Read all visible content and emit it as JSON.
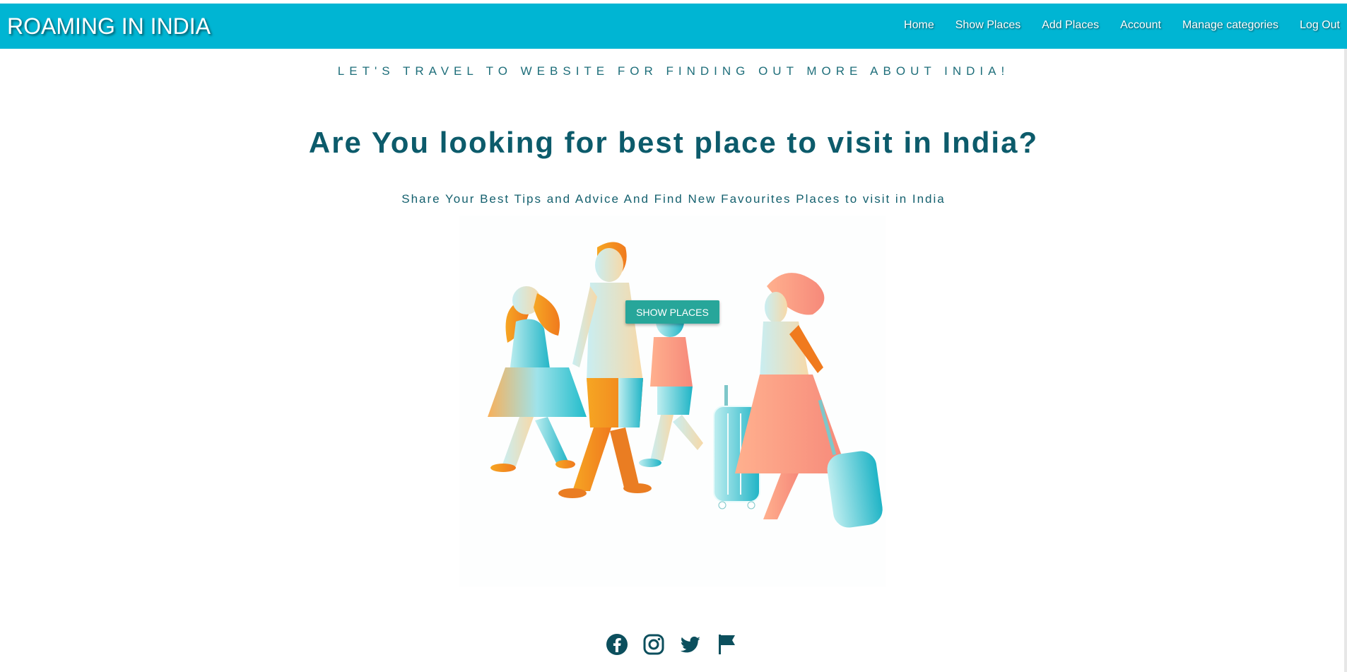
{
  "brand": {
    "title": "ROAMING IN INDIA"
  },
  "nav": {
    "items": [
      {
        "label": "Home",
        "icon": ""
      },
      {
        "label": "Show Places",
        "icon": ""
      },
      {
        "label": "Add Places",
        "icon": ""
      },
      {
        "label": "Account",
        "icon": ""
      },
      {
        "label": "Manage categories",
        "icon": ""
      },
      {
        "label": "Log Out",
        "icon": ""
      }
    ]
  },
  "hero": {
    "tagline": "LET'S TRAVEL TO WEBSITE FOR FINDING OUT MORE ABOUT INDIA!",
    "headline": "Are You looking for best place to visit in India?",
    "subheadline": "Share Your Best Tips and Advice And Find New Favourites Places to visit in India",
    "button_label": "SHOW PLACES",
    "illustration": "family-travel-illustration"
  },
  "footer": {
    "socials": [
      "facebook-icon",
      "instagram-icon",
      "twitter-icon",
      "flag-icon"
    ]
  },
  "colors": {
    "navbar": "#00b5d3",
    "heading": "#0c5b6b",
    "button": "#27a69a",
    "social": "#0c4f5d"
  }
}
